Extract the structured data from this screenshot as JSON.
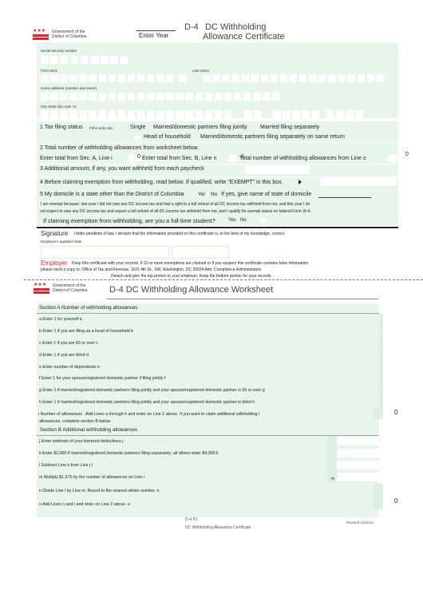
{
  "header": {
    "logo_line1": "Government of the",
    "logo_line2": "District of Columbia",
    "enter_year_label": "Enter Year",
    "form_code": "D-4",
    "title_line1": "DC Withholding",
    "title_line2": "Allowance Certificate"
  },
  "identity": {
    "ssn_label": "Social security number",
    "first_name_label": "First name",
    "last_name_label": "Last name",
    "address_label": "Home address (number and street)",
    "city_label": "City State Zip code +4"
  },
  "lines": {
    "line1_label": "1  Tax filing status",
    "line1_hint": "Fill in only one:",
    "status_options": [
      "Single",
      "Married/domestic partners filing jointly",
      "Married filing separately",
      "Head of household",
      "Married/domestic partners filing separately on same return"
    ],
    "line2_label": "2  Total number of withholding allowances from worksheet below.",
    "line2_sec_a": "Enter total from Sec. A, Line i",
    "line2_sec_a_value": "0",
    "line2_sec_b": "Enter total from Sec. B, Line n",
    "line2_sec_b_value": "0",
    "line2_total": "Total number of withholding allowances from Line o",
    "line2_total_value": "0",
    "line3_label": "3  Additional amount, if any, you want withheld from each paycheck",
    "line3_currency": "$",
    "line4_label": "4  Before claiming exemption from withholding, read below.  If qualified, write \"EXEMPT\" in this box.",
    "line5_label": "5 My domicile is a state other than the District of Columbia",
    "line5_yes": "Yes",
    "line5_no": "No",
    "line5_followup": "If yes, give name of state of domicile",
    "exempt_text_1": "I am exempt because: last year I did not owe any DC income tax and had a right to a full refund of all DC income tax withheld from me; and this year I do",
    "exempt_text_2": "not expect to owe any DC income tax and expect a full refund of all DC income tax withheld from me; and I qualify for exempt status on federal Form W-4.",
    "student_question": "If claiming exemption from withholding, are you a full-time student?",
    "student_yes": "Yes",
    "student_no": "No"
  },
  "signature": {
    "title": "Signature",
    "declaration": "Under penalties of law, I declare that the information provided on this certificate is, to the best of my knowledge, correct.",
    "field_labels": "Employee's signature Date"
  },
  "employer": {
    "title": "Employer",
    "text_1": "Keep this certificate with your records. If 10 or more exemptions are claimed or if you suspect this certificate contains false information",
    "text_2": "please send a copy to: Office of Tax and Revenue, 1101 4th St., SW, Washington, DC 20024  Attn: Compliance Administration",
    "detach": "Detach and give the top portion to your employer. Keep the bottom portion for your records."
  },
  "worksheet": {
    "title": "D-4 DC Withholding Allowance Worksheet",
    "section_a_title": "Section A  Number of withholding allowances",
    "section_a_rows": [
      {
        "text": "a Enter 1 for yourself  a",
        "value": ""
      },
      {
        "text": "b Enter 1 if you are filing as a head of household  b",
        "value": ""
      },
      {
        "text": "c Enter 1 if you are 65 or over  c",
        "value": ""
      },
      {
        "text": "d Enter 1 if you are blind d",
        "value": ""
      },
      {
        "text": "e Enter number of dependents e",
        "value": ""
      },
      {
        "text": "f Enter 1 for your spouse/registered domestic partner if filing jointly  f",
        "value": ""
      },
      {
        "text": "g Enter 1 if married/registered domestic partners filing jointly and your spouse/registered domestic partner is 65 or over  g",
        "value": ""
      },
      {
        "text": "h Enter 1 if married/registered domestic partners filing jointly and your spouse/registered domestic partner is blind  h",
        "value": ""
      }
    ],
    "line_i_text_1": "i Number of allowances .  Add Lines a through h and enter on Line 2 above.  If you want to claim additional withholding i",
    "line_i_text_2": "allowances, complete section B below.",
    "line_i_value": "0",
    "section_b_title": "Section B  Additional withholding allowances",
    "section_b_rows": [
      {
        "text": "j Enter estimate of your itemized deductions  j",
        "value": ""
      },
      {
        "text": "k Enter $2,000 if married/registered domestic partners filing separately; all others enter $4,000  k",
        "value": ""
      },
      {
        "text": "l Subtract Line k from Line j l",
        "value": ""
      },
      {
        "text": "m Multiply $1,675 by the number of allowances on Line i",
        "value": ""
      }
    ],
    "line_m_marker": "m",
    "line_n_text": "n Divide Line l by Line m. Round to the nearest whole number. n",
    "line_n_value": "",
    "line_o_text": "o Add Lines n and i and enter on Line 2 above.  o",
    "line_o_value": "0"
  },
  "footer": {
    "code": "D-4  P1",
    "name": "DC Withholding Allowance Certificate",
    "revised": "Revised 12/2013"
  },
  "colors": {
    "accent_red": "#e2262f",
    "form_green": "#e7f5ea"
  }
}
